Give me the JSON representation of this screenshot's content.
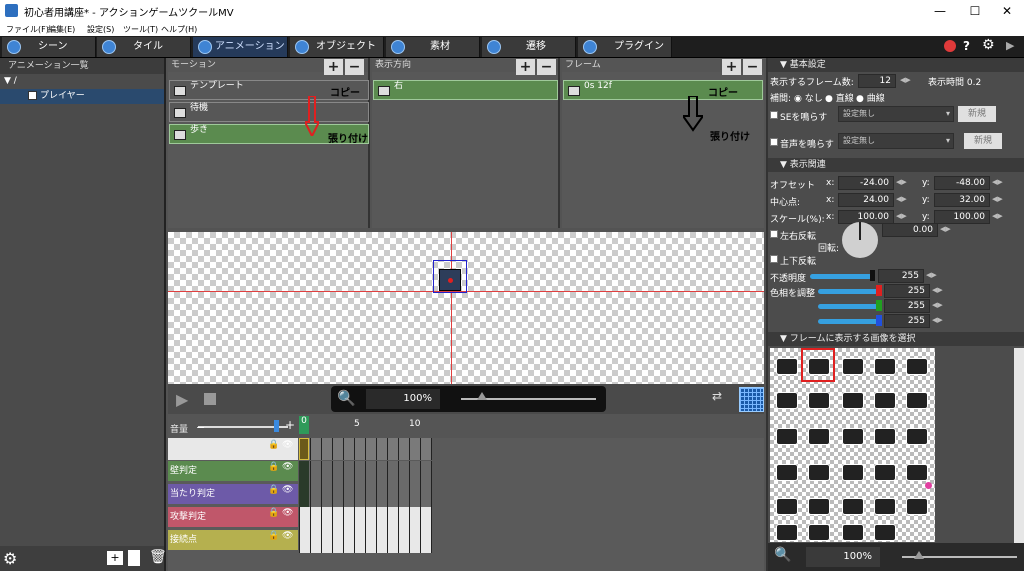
{
  "window": {
    "title": "初心者用講座* - アクションゲームツクールMV",
    "min": "—",
    "max": "☐",
    "close": "✕"
  },
  "menu": [
    "ファイル(F)",
    "編集(E)",
    "設定(S)",
    "ツール(T)",
    "ヘルプ(H)"
  ],
  "tabs": [
    {
      "label": "シーン",
      "active": false
    },
    {
      "label": "タイル",
      "active": false
    },
    {
      "label": "アニメーション",
      "active": true
    },
    {
      "label": "オブジェクト",
      "active": false
    },
    {
      "label": "素材",
      "active": false
    },
    {
      "label": "遷移",
      "active": false
    },
    {
      "label": "プラグイン",
      "active": false
    }
  ],
  "top_icons": {
    "play": "▶",
    "help": "?",
    "gear": "⚙",
    "close": "●"
  },
  "sidebar": {
    "header": "アニメーション一覧",
    "root": "/",
    "items": [
      {
        "label": "プレイヤー",
        "selected": true
      }
    ]
  },
  "motion": {
    "header": "モーション",
    "items": [
      {
        "label": "テンプレート"
      },
      {
        "label": "待機"
      },
      {
        "label": "歩き",
        "selected": true
      }
    ],
    "annot_copy": "コピー",
    "annot_paste": "張り付け"
  },
  "direction": {
    "header": "表示方向",
    "items": [
      {
        "label": "右",
        "selected": true
      }
    ]
  },
  "frame": {
    "header": "フレーム",
    "items": [
      {
        "label": "0s 12f",
        "selected": true
      }
    ],
    "annot_copy": "コピー",
    "annot_paste": "張り付け"
  },
  "playbar": {
    "zoom": "100%"
  },
  "timeline": {
    "volume_label": "音量",
    "ticks": [
      "0",
      "5",
      "10"
    ],
    "rows": [
      {
        "label": "",
        "color": "#e8e8e8"
      },
      {
        "label": "壁判定",
        "color": "#5b8b4f"
      },
      {
        "label": "当たり判定",
        "color": "#6d5aa8"
      },
      {
        "label": "攻撃判定",
        "color": "#c0576a"
      },
      {
        "label": "接続点",
        "color": "#b5b04f"
      }
    ]
  },
  "right": {
    "basic_header": "基本設定",
    "frame_count_label": "表示するフレーム数:",
    "frame_count": "12",
    "display_time_label": "表示時間 0.2",
    "interp_label": "補間:",
    "interp_options": [
      "なし",
      "直線",
      "曲線"
    ],
    "se_label": "SEを鳴らす",
    "se_value": "設定無し",
    "new_label": "新規",
    "voice_label": "音声を鳴らす",
    "voice_value": "設定無し",
    "display_header": "表示関連",
    "offset_label": "オフセット",
    "center_label": "中心点:",
    "scale_label": "スケール(%):",
    "x_label": "x:",
    "y_label": "y:",
    "offset_x": "-24.00",
    "offset_y": "-48.00",
    "center_x": "24.00",
    "center_y": "32.00",
    "scale_x": "100.00",
    "scale_y": "100.00",
    "flip_h_label": "左右反転",
    "flip_v_label": "上下反転",
    "rotate_label": "回転:",
    "rotate_value": "0.00",
    "opacity_label": "不透明度",
    "opacity_value": "255",
    "hue_label": "色相を調整",
    "r_value": "255",
    "g_value": "255",
    "b_value": "255",
    "image_header": "フレームに表示する画像を選択",
    "zoom": "100%"
  }
}
